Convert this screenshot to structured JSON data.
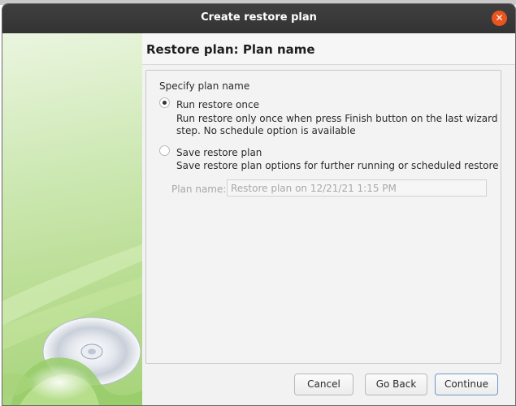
{
  "window": {
    "title": "Create restore plan",
    "close_icon": "close-icon"
  },
  "page": {
    "heading": "Restore plan: Plan name"
  },
  "panel": {
    "group_label": "Specify plan name",
    "options": [
      {
        "label": "Run restore once",
        "description_line1": "Run restore only once when press Finish button on the last wizard",
        "description_line2": "step. No schedule option is available",
        "checked": true
      },
      {
        "label": "Save restore plan",
        "description_line1": "Save restore plan options for further running or scheduled restore",
        "checked": false
      }
    ],
    "plan_name": {
      "label": "Plan name:",
      "value": "Restore plan on 12/21/21 1:15 PM",
      "disabled": true
    }
  },
  "buttons": {
    "cancel": "Cancel",
    "go_back": "Go Back",
    "continue": "Continue"
  },
  "colors": {
    "titlebar": "#3a3a3a",
    "close": "#e9541f",
    "sidebar_green": "#b7dc90",
    "primary_border": "#6f95c9"
  }
}
